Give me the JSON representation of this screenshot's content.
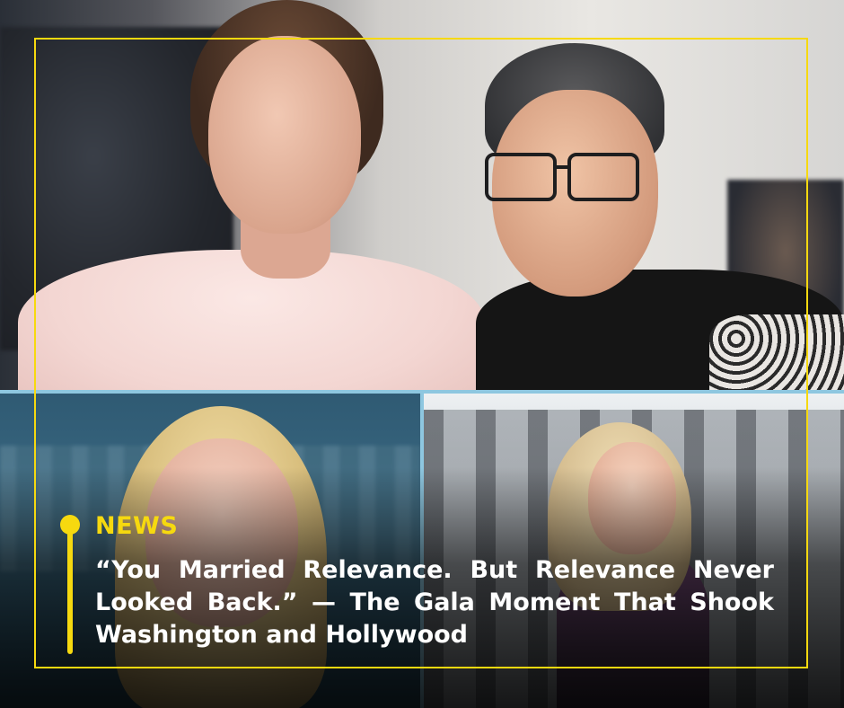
{
  "post": {
    "category": "NEWS",
    "headline": "“You Married Relevance. But Relevance Never Looked Back.” — The Gala Moment That Shook Washington and Hollywood"
  },
  "colors": {
    "accent": "#f6d90f",
    "divider": "#8ec7e0",
    "headline_text": "#ffffff"
  },
  "images": {
    "top": "couple-at-gala-photo",
    "bottom_left": "blonde-woman-newsroom-photo",
    "bottom_right": "blonde-woman-outside-government-building-photo"
  }
}
